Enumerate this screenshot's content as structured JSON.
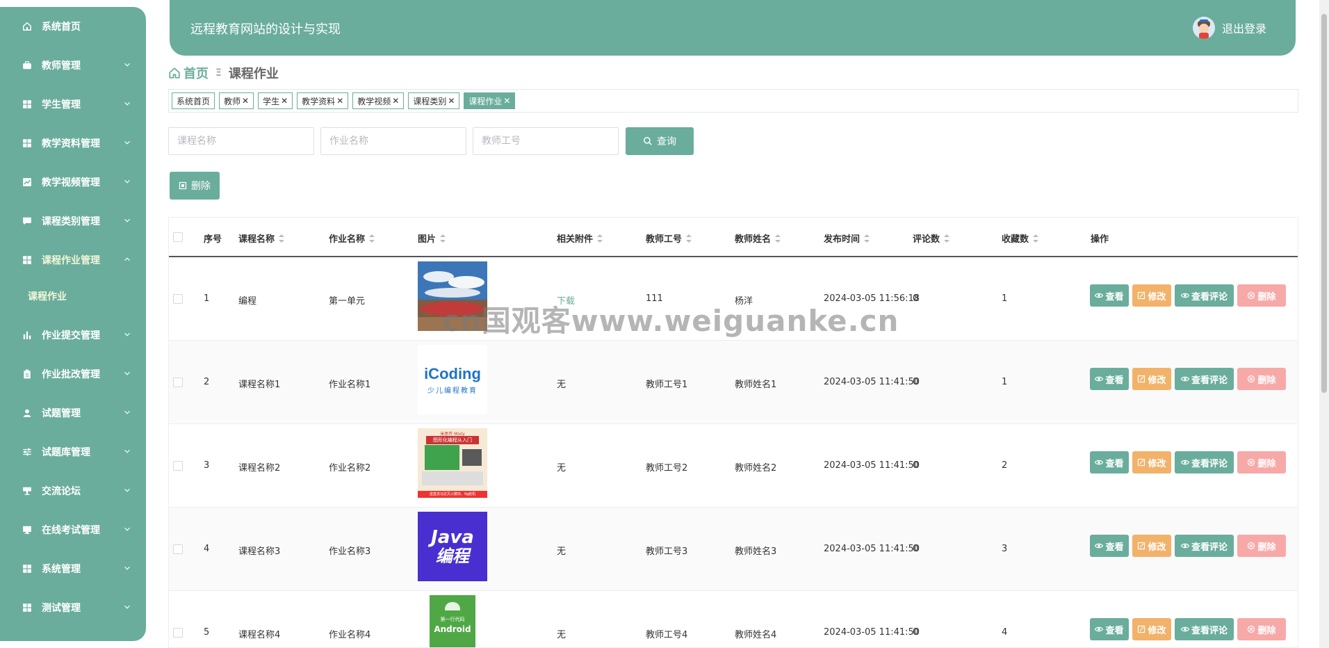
{
  "header": {
    "app_title": "远程教育网站的设计与实现",
    "logout_label": "退出登录"
  },
  "sidebar": {
    "items": [
      {
        "label": "系统首页",
        "icon": "home-icon",
        "has_children": false
      },
      {
        "label": "教师管理",
        "icon": "briefcase-icon",
        "has_children": true
      },
      {
        "label": "学生管理",
        "icon": "grid-icon",
        "has_children": true
      },
      {
        "label": "教学资料管理",
        "icon": "grid-icon",
        "has_children": true
      },
      {
        "label": "教学视频管理",
        "icon": "chart-icon",
        "has_children": true
      },
      {
        "label": "课程类别管理",
        "icon": "chat-icon",
        "has_children": true
      },
      {
        "label": "课程作业管理",
        "icon": "grid-icon",
        "has_children": true,
        "expanded": true
      },
      {
        "label": "作业提交管理",
        "icon": "bar-chart-icon",
        "has_children": true
      },
      {
        "label": "作业批改管理",
        "icon": "clipboard-icon",
        "has_children": true
      },
      {
        "label": "试题管理",
        "icon": "user-icon",
        "has_children": true
      },
      {
        "label": "试题库管理",
        "icon": "sliders-icon",
        "has_children": true
      },
      {
        "label": "交流论坛",
        "icon": "podium-icon",
        "has_children": true
      },
      {
        "label": "在线考试管理",
        "icon": "monitor-icon",
        "has_children": true
      },
      {
        "label": "系统管理",
        "icon": "grid-icon",
        "has_children": true
      },
      {
        "label": "测试管理",
        "icon": "grid-icon",
        "has_children": true
      }
    ],
    "sub_item": "课程作业"
  },
  "breadcrumb": {
    "home": "首页",
    "current": "课程作业"
  },
  "tags": [
    {
      "label": "系统首页",
      "closable": false,
      "active": false
    },
    {
      "label": "教师",
      "closable": true,
      "active": false
    },
    {
      "label": "学生",
      "closable": true,
      "active": false
    },
    {
      "label": "教学资料",
      "closable": true,
      "active": false
    },
    {
      "label": "教学视频",
      "closable": true,
      "active": false
    },
    {
      "label": "课程类别",
      "closable": true,
      "active": false
    },
    {
      "label": "课程作业",
      "closable": true,
      "active": true
    }
  ],
  "search": {
    "course_placeholder": "课程名称",
    "homework_placeholder": "作业名称",
    "teacher_id_placeholder": "教师工号",
    "query_label": "查询"
  },
  "toolbar": {
    "delete_label": "删除"
  },
  "table": {
    "columns": [
      "序号",
      "课程名称",
      "作业名称",
      "图片",
      "相关附件",
      "教师工号",
      "教师姓名",
      "发布时间",
      "评论数",
      "收藏数",
      "操作"
    ],
    "rows": [
      {
        "index": "1",
        "course": "编程",
        "homework": "第一单元",
        "attachment": "下载",
        "teacher_id": "111",
        "teacher_name": "杨洋",
        "time": "2024-03-05 11:56:18",
        "comments": "0",
        "favorites": "1",
        "image": "landscape"
      },
      {
        "index": "2",
        "course": "课程名称1",
        "homework": "作业名称1",
        "attachment": "无",
        "teacher_id": "教师工号1",
        "teacher_name": "教师姓名1",
        "time": "2024-03-05 11:41:50",
        "comments": "0",
        "favorites": "1",
        "image": "icoding"
      },
      {
        "index": "3",
        "course": "课程名称2",
        "homework": "作业名称2",
        "attachment": "无",
        "teacher_id": "教师工号2",
        "teacher_name": "教师姓名2",
        "time": "2024-03-05 11:41:50",
        "comments": "0",
        "favorites": "2",
        "image": "mixly"
      },
      {
        "index": "4",
        "course": "课程名称3",
        "homework": "作业名称3",
        "attachment": "无",
        "teacher_id": "教师工号3",
        "teacher_name": "教师姓名3",
        "time": "2024-03-05 11:41:50",
        "comments": "0",
        "favorites": "3",
        "image": "java"
      },
      {
        "index": "5",
        "course": "课程名称4",
        "homework": "作业名称4",
        "attachment": "无",
        "teacher_id": "教师工号4",
        "teacher_name": "教师姓名4",
        "time": "2024-03-05 11:41:50",
        "comments": "0",
        "favorites": "4",
        "image": "android"
      }
    ],
    "ops": {
      "view": "查看",
      "edit": "修改",
      "view_comments": "查看评论",
      "delete": "删除"
    }
  },
  "thumb_text": {
    "icoding_logo": "iCoding",
    "icoding_sub": "少儿编程教育",
    "mixly_top": "米思齐 Mixly",
    "mixly_title": "图形化编程从入门",
    "mixly_bottom": "送直流马达灭火模块、9g舵机",
    "java_line1": "Java",
    "java_line2": "编程",
    "android_top": "第一行代码",
    "android_title": "Android"
  },
  "watermark": "cn国观客www.weiguanke.cn",
  "colors": {
    "primary": "#6aad9c",
    "edit": "#f2b26a",
    "delete": "#f7a9a8"
  }
}
